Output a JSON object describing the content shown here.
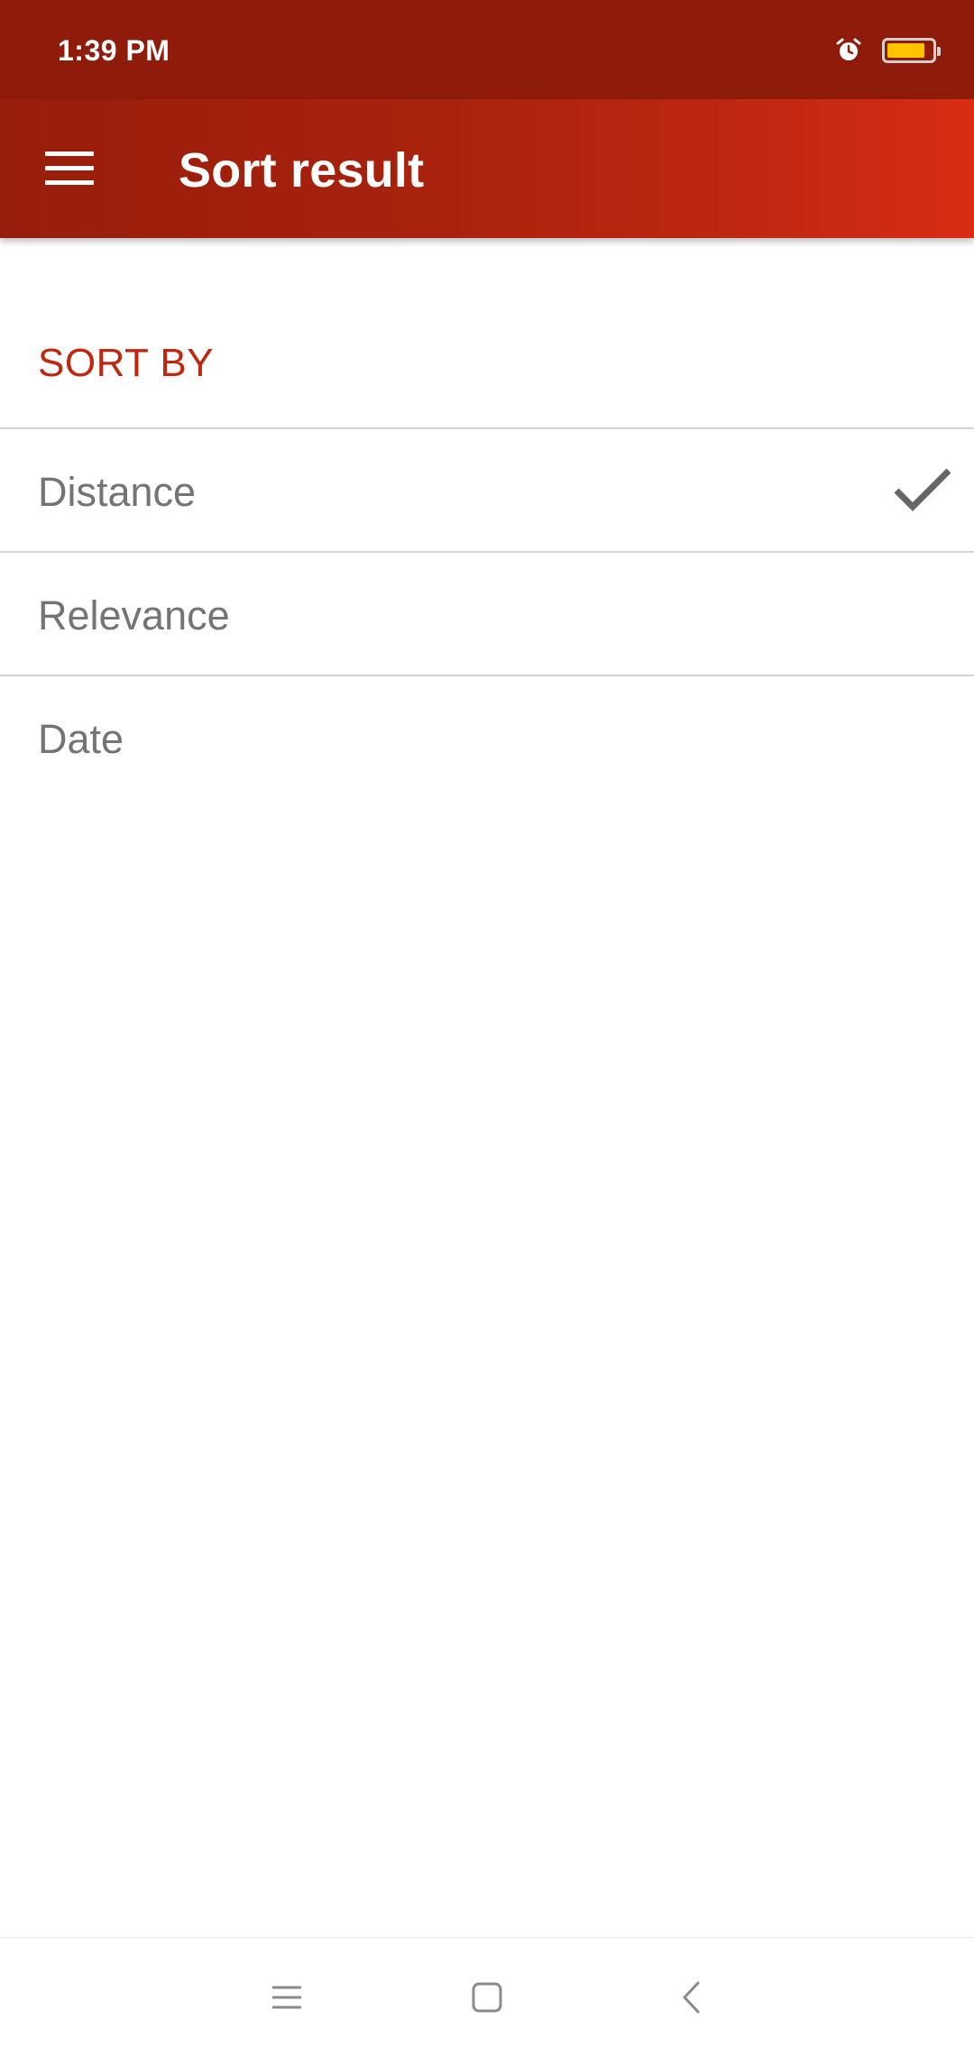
{
  "status_bar": {
    "time": "1:39 PM",
    "icons": [
      "alarm-icon",
      "battery-icon"
    ],
    "battery_level": 0.85,
    "battery_color": "#ffc300"
  },
  "app_bar": {
    "title": "Sort result",
    "menu_icon": "menu-icon",
    "gradient_start": "#971d0c",
    "gradient_end": "#d92d12"
  },
  "sort": {
    "header": "SORT BY",
    "accent_color": "#c1260f",
    "options": [
      {
        "label": "Distance",
        "selected": true
      },
      {
        "label": "Relevance",
        "selected": false
      },
      {
        "label": "Date",
        "selected": false
      }
    ]
  },
  "nav_bar": {
    "buttons": [
      "recents-icon",
      "home-icon",
      "back-icon"
    ]
  }
}
